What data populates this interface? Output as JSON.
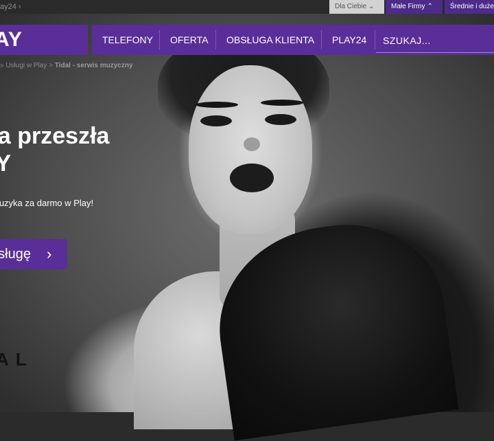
{
  "topbar": {
    "crumb": "ay24 ›",
    "segments": {
      "dla_ciebie": "Dla Ciebie",
      "male_firmy": "Małe Firmy",
      "srednie": "Średnie i duże"
    }
  },
  "nav": {
    "logo": "AY",
    "items": [
      "TELEFONY",
      "OFERTA",
      "OBSŁUGA KLIENTA",
      "PLAY24"
    ],
    "search_placeholder": "SZUKAJ..."
  },
  "breadcrumb": {
    "prefix": "» Usługi w Play  >",
    "current": "Tidal - serwis muzyczny"
  },
  "hero": {
    "headline_line1": "ka przeszła",
    "headline_line2": "AY",
    "subtitle": "muzyka za darmo w Play!",
    "cta_label": "usługę",
    "cta_arrow": "›",
    "brand": "AL"
  },
  "colors": {
    "brand_purple": "#5a2e98",
    "nav_divider": "#7c56b4"
  }
}
